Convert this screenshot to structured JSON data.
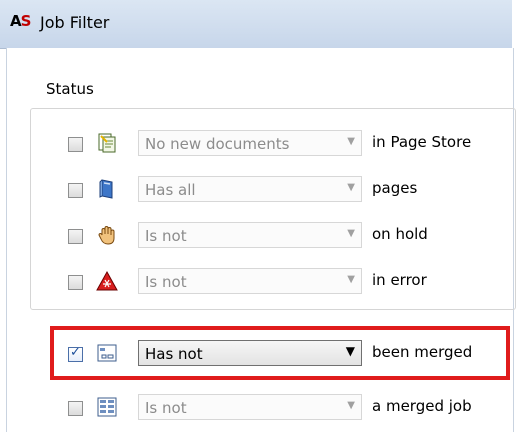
{
  "window": {
    "app_icon": "AS",
    "title": "Job Filter"
  },
  "status_group": {
    "label": "Status"
  },
  "rows": [
    {
      "checked": false,
      "icon": "page-store-icon",
      "value": "No new documents",
      "suffix": "in Page Store"
    },
    {
      "checked": false,
      "icon": "pages-icon",
      "value": "Has all",
      "suffix": "pages"
    },
    {
      "checked": false,
      "icon": "hand-hold-icon",
      "value": "Is not",
      "suffix": "on hold"
    },
    {
      "checked": false,
      "icon": "error-warning-icon",
      "value": "Is not",
      "suffix": "in error"
    },
    {
      "checked": true,
      "icon": "merge-icon",
      "value": "Has not",
      "suffix": "been merged"
    },
    {
      "checked": false,
      "icon": "merged-job-icon",
      "value": "Is not",
      "suffix": "a merged job"
    }
  ],
  "highlight_color": "#e01c1c"
}
